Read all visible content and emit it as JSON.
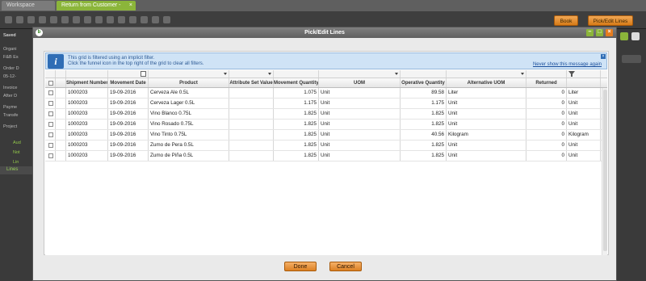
{
  "app": {
    "tabs": [
      {
        "label": "Workspace"
      },
      {
        "label": "Return from Customer - 1000000..."
      }
    ],
    "header_buttons": {
      "book": "Book",
      "pick_edit": "Pick/Edit Lines"
    },
    "left_labels": [
      "Saved",
      "Organi",
      "F&B Es",
      "Order D",
      "05-12-",
      "Invoice",
      "After D",
      "Payme",
      "Transfe",
      "Project",
      "Aud",
      "Not",
      "Lin"
    ],
    "lines_tab": "Lines"
  },
  "dialog": {
    "title": "Pick/Edit Lines",
    "info": {
      "line1": "This grid is filtered using an implicit filter.",
      "line2": "Click the funnel icon in the top right of the grid to clear all filters.",
      "never_show": "Never show this message again"
    },
    "columns": [
      "Shipment Number",
      "Movement Date",
      "Product",
      "Attribute Set Value",
      "Movement Quantity",
      "UOM",
      "Operative Quantity",
      "Alternative UOM",
      "Returned"
    ],
    "rows": [
      {
        "shipment": "1000203",
        "date": "19-09-2016",
        "product": "Cerveza Ale 0.5L",
        "attr": "",
        "mov_qty": "1.075",
        "uom": "Unit",
        "op_qty": "89.58",
        "alt_uom": "Liter",
        "returned": "0",
        "uom2": "Liter"
      },
      {
        "shipment": "1000203",
        "date": "19-09-2016",
        "product": "Cerveza Lager 0.5L",
        "attr": "",
        "mov_qty": "1.175",
        "uom": "Unit",
        "op_qty": "1.175",
        "alt_uom": "Unit",
        "returned": "0",
        "uom2": "Unit"
      },
      {
        "shipment": "1000203",
        "date": "19-09-2016",
        "product": "Vino Blanco 0.75L",
        "attr": "",
        "mov_qty": "1.825",
        "uom": "Unit",
        "op_qty": "1.825",
        "alt_uom": "Unit",
        "returned": "0",
        "uom2": "Unit"
      },
      {
        "shipment": "1000203",
        "date": "19-09-2016",
        "product": "Vino Rosado 0.75L",
        "attr": "",
        "mov_qty": "1.825",
        "uom": "Unit",
        "op_qty": "1.825",
        "alt_uom": "Unit",
        "returned": "0",
        "uom2": "Unit"
      },
      {
        "shipment": "1000203",
        "date": "19-09-2016",
        "product": "Vino Tinto 0.75L",
        "attr": "",
        "mov_qty": "1.825",
        "uom": "Unit",
        "op_qty": "40.56",
        "alt_uom": "Kilogram",
        "returned": "0",
        "uom2": "Kilogram"
      },
      {
        "shipment": "1000203",
        "date": "19-09-2016",
        "product": "Zumo de Pera 0.5L",
        "attr": "",
        "mov_qty": "1.825",
        "uom": "Unit",
        "op_qty": "1.825",
        "alt_uom": "Unit",
        "returned": "0",
        "uom2": "Unit"
      },
      {
        "shipment": "1000203",
        "date": "19-09-2016",
        "product": "Zumo de Piña 0.5L",
        "attr": "",
        "mov_qty": "1.825",
        "uom": "Unit",
        "op_qty": "1.825",
        "alt_uom": "Unit",
        "returned": "0",
        "uom2": "Unit"
      }
    ],
    "done": "Done",
    "cancel": "Cancel"
  },
  "colors": {
    "accent_green": "#8bb53a",
    "button_orange": "#dc8124",
    "info_blue": "#2f6db5"
  }
}
